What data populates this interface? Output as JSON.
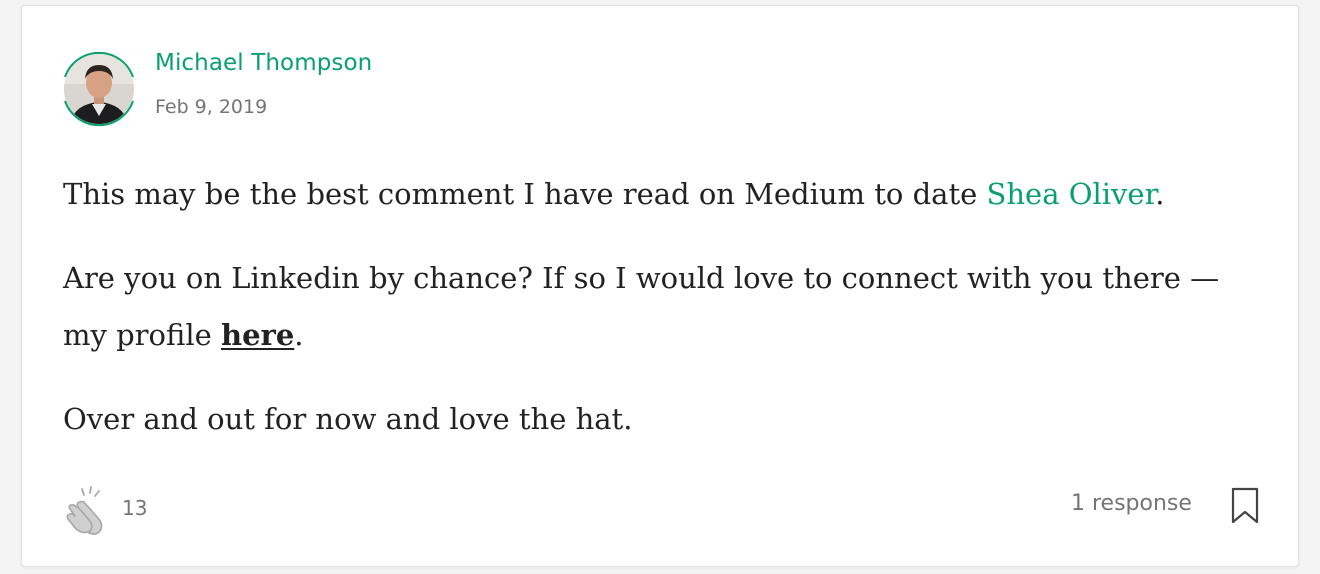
{
  "author": {
    "name": "Michael Thompson",
    "date": "Feb 9, 2019"
  },
  "comment": {
    "p1_text": "This may be the best comment I have read on Medium to date ",
    "p1_mention": "Shea Oliver",
    "p1_end": ".",
    "p2_text": "Are you on Linkedin by chance? If so I would love to connect with you there —my profile ",
    "p2_link": "here",
    "p2_end": ".",
    "p3_text": "Over and out for now and love the hat."
  },
  "footer": {
    "clap_count": "13",
    "responses_label": "1 response"
  },
  "icons": {
    "avatar": "avatar-photo",
    "clap": "clap-icon",
    "bookmark": "bookmark-icon"
  },
  "colors": {
    "accent": "#0aa06e",
    "text": "#222222",
    "muted": "#757575"
  }
}
